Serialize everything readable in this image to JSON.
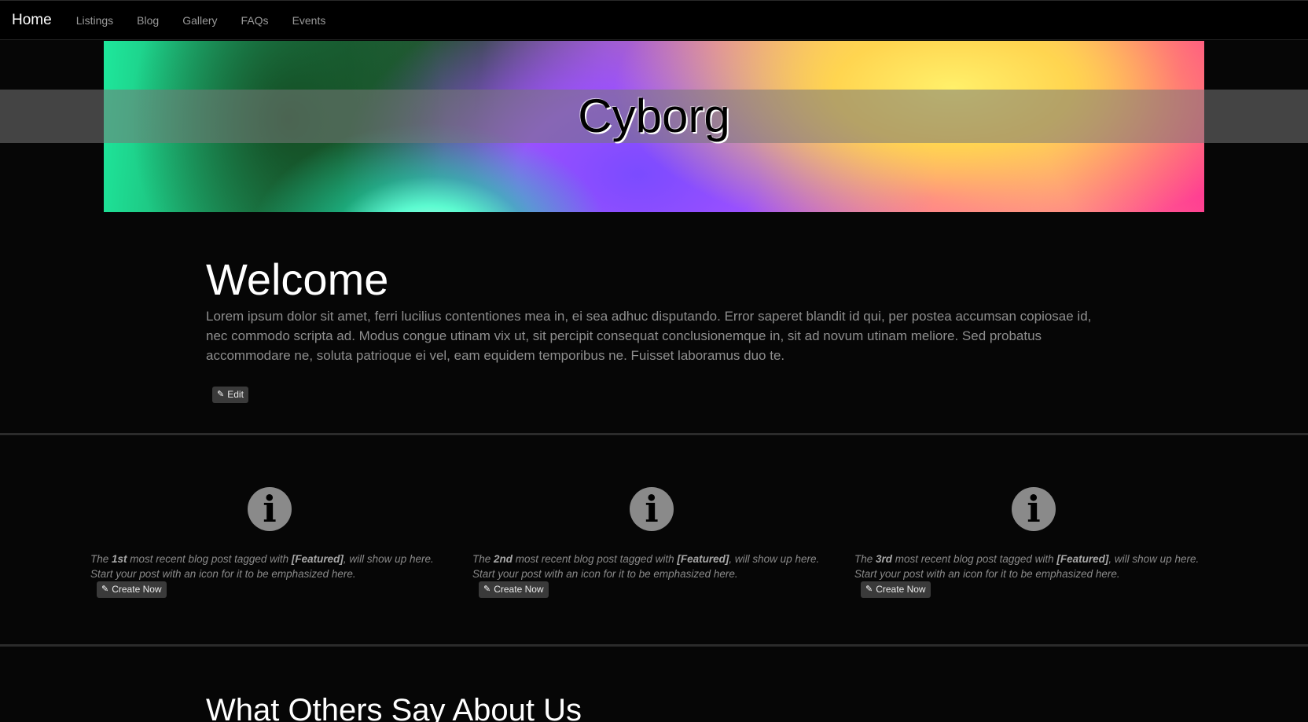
{
  "nav": {
    "brand": "Home",
    "items": [
      "Listings",
      "Blog",
      "Gallery",
      "FAQs",
      "Events"
    ]
  },
  "hero": {
    "title": "Cyborg"
  },
  "welcome": {
    "heading": "Welcome",
    "body": "Lorem ipsum dolor sit amet, ferri lucilius contentiones mea in, ei sea adhuc disputando. Error saperet blandit id qui, per postea accumsan copiosae id, nec commodo scripta ad. Modus congue utinam vix ut, sit percipit consequat conclusionemque in, sit ad novum utinam meliore. Sed probatus accommodare ne, soluta patrioque ei vel, eam equidem temporibus ne. Fuisset laboramus duo te.",
    "edit_label": "Edit"
  },
  "features": [
    {
      "pre": "The ",
      "ordinal": "1st",
      "mid": " most recent blog post tagged with ",
      "tag": "[Featured]",
      "post": ", will show up here.",
      "line2": "Start your post with an icon for it to be emphasized here.",
      "button": "Create Now"
    },
    {
      "pre": "The ",
      "ordinal": "2nd",
      "mid": " most recent blog post tagged with ",
      "tag": "[Featured]",
      "post": ", will show up here.",
      "line2": "Start your post with an icon for it to be emphasized here.",
      "button": "Create Now"
    },
    {
      "pre": "The ",
      "ordinal": "3rd",
      "mid": " most recent blog post tagged with ",
      "tag": "[Featured]",
      "post": ", will show up here.",
      "line2": "Start your post with an icon for it to be emphasized here.",
      "button": "Create Now"
    }
  ],
  "icons": {
    "feature": "info-circle-icon",
    "edit": "pencil-icon"
  },
  "testimonials": {
    "heading": "What Others Say About Us"
  },
  "colors": {
    "background": "#060606",
    "navbar": "#000000",
    "button": "#3a3a3a",
    "info_icon": "#8a8a8a"
  }
}
